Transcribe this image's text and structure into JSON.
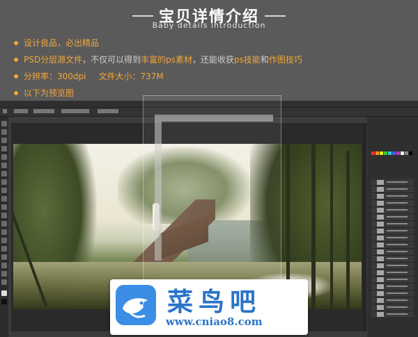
{
  "header": {
    "title": "宝贝详情介绍",
    "subtitle": "Baby details introduction"
  },
  "bullets": [
    {
      "text": "设计良品，必出精品"
    },
    {
      "parts": [
        "PSD分层源文件",
        "，不仅可以得到",
        "丰富的ps素材",
        "，还能收获",
        "ps技能",
        "和",
        "作图技巧"
      ]
    },
    {
      "parts": [
        "分辨率：300dpi",
        "文件大小：737M"
      ]
    },
    {
      "text": "以下为预览图"
    }
  ],
  "colors": {
    "accent": "#f3a53a",
    "bullet_text": "#cfcfcf",
    "background": "#595959",
    "ps_panel": "#3c3c3c",
    "watermark_blue": "#2a73c9"
  },
  "watermark": {
    "brand": "菜鸟吧",
    "url": "www.cniao8.com",
    "logo_icon": "bird-logo-icon"
  }
}
